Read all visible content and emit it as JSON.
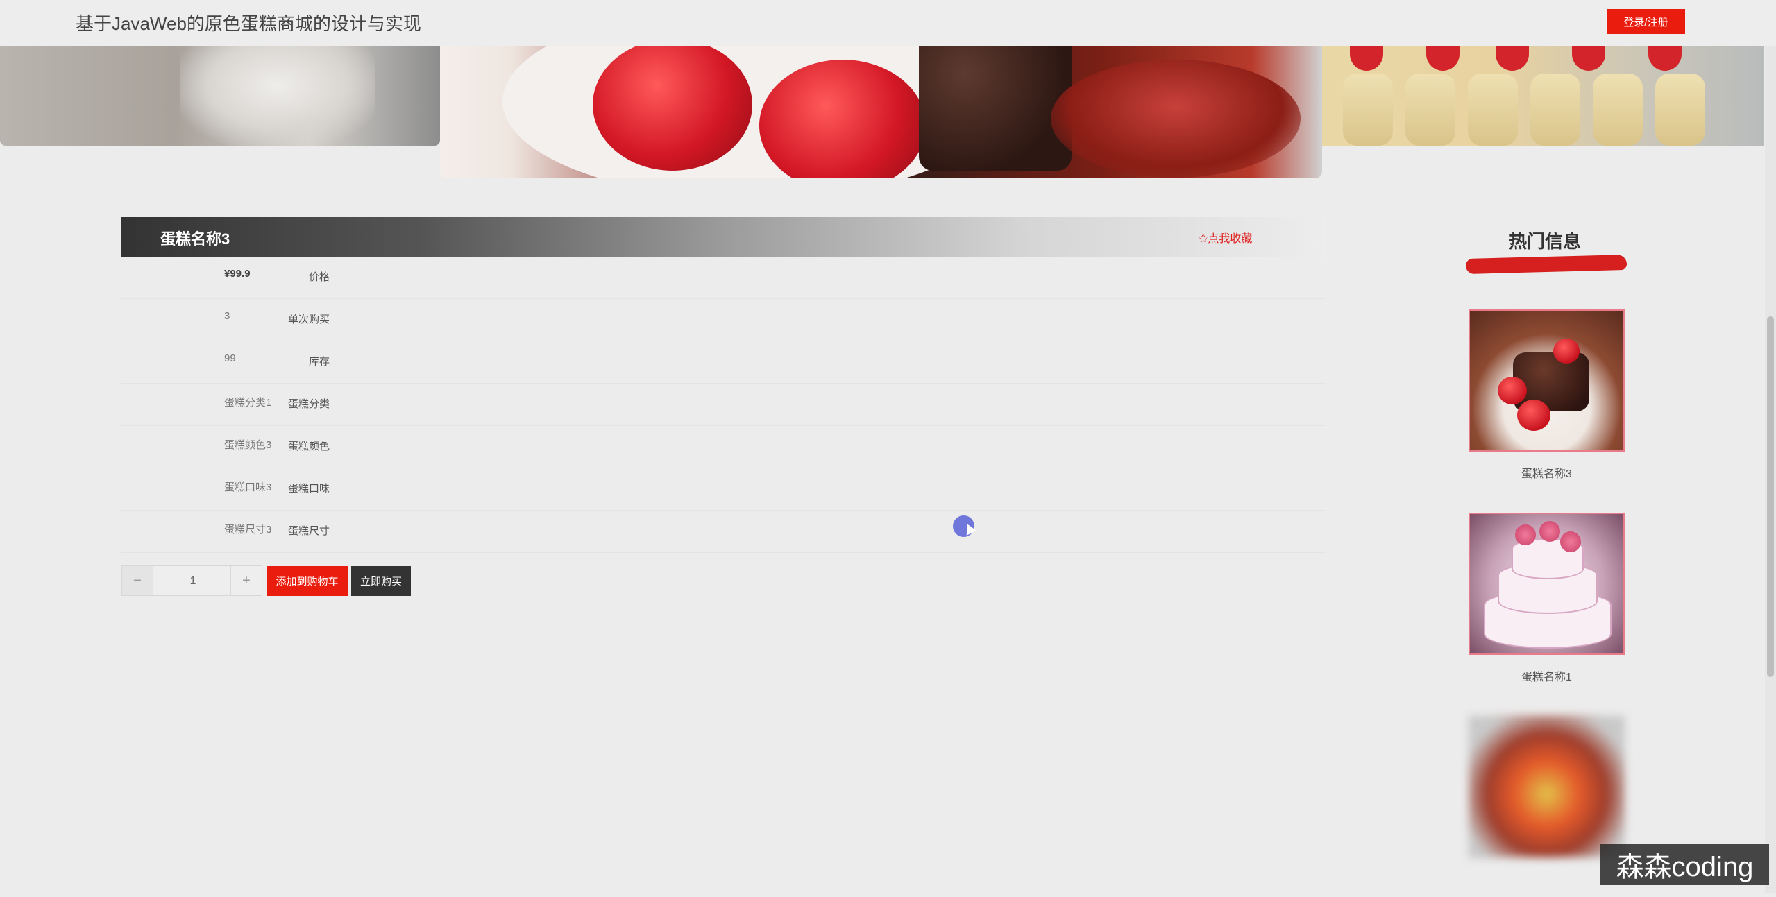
{
  "header": {
    "site_title": "基于JavaWeb的原色蛋糕商城的设计与实现",
    "login_label": "登录/注册"
  },
  "banner": {
    "slide_count": 3,
    "active_slide": 1
  },
  "product": {
    "name": "蛋糕名称3",
    "favorite_label": "✩点我收藏",
    "attributes": [
      {
        "label": "价格",
        "value": "¥99.9"
      },
      {
        "label": "单次购买",
        "value": "3"
      },
      {
        "label": "库存",
        "value": "99"
      },
      {
        "label": "蛋糕分类",
        "value": "蛋糕分类1"
      },
      {
        "label": "蛋糕颜色",
        "value": "蛋糕颜色3"
      },
      {
        "label": "蛋糕口味",
        "value": "蛋糕口味3"
      },
      {
        "label": "蛋糕尺寸",
        "value": "蛋糕尺寸3"
      }
    ]
  },
  "purchase": {
    "minus": "−",
    "plus": "+",
    "quantity": "1",
    "add_to_cart": "添加到购物车",
    "buy_now": "立即购买"
  },
  "sidebar": {
    "title": "热门信息",
    "items": [
      {
        "name": "蛋糕名称3",
        "image": "chocolate-raspberry-cake"
      },
      {
        "name": "蛋糕名称1",
        "image": "tiered-pink-cake"
      },
      {
        "name": "",
        "image": "fruit-tart-blurred"
      }
    ]
  },
  "watermark": "森森coding",
  "colors": {
    "accent": "#ea1c0e",
    "dark_button": "#333333",
    "background": "#ececec"
  }
}
